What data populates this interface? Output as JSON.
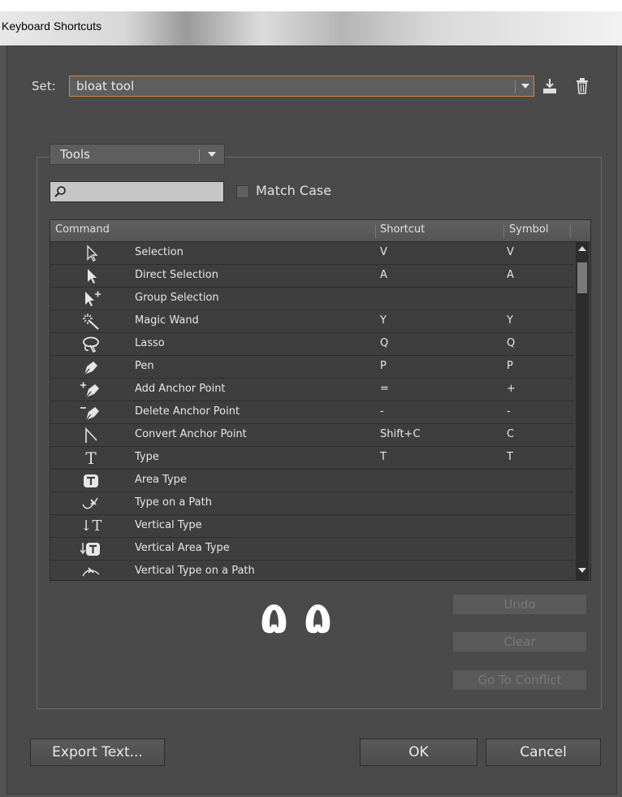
{
  "window": {
    "title": "Keyboard Shortcuts"
  },
  "set": {
    "label": "Set:",
    "value": "bloat tool",
    "save_icon": "save-set-icon",
    "delete_icon": "trash-icon"
  },
  "tools": {
    "category": "Tools",
    "search": {
      "value": "",
      "placeholder": ""
    },
    "match_case_label": "Match Case",
    "columns": [
      "Command",
      "Shortcut",
      "Symbol"
    ],
    "rows": [
      {
        "icon": "selection-arrow-icon",
        "command": "Selection",
        "shortcut": "V",
        "symbol": "V"
      },
      {
        "icon": "direct-selection-icon",
        "command": "Direct Selection",
        "shortcut": "A",
        "symbol": "A"
      },
      {
        "icon": "group-selection-icon",
        "command": "Group Selection",
        "shortcut": "",
        "symbol": ""
      },
      {
        "icon": "magic-wand-icon",
        "command": "Magic Wand",
        "shortcut": "Y",
        "symbol": "Y"
      },
      {
        "icon": "lasso-icon",
        "command": "Lasso",
        "shortcut": "Q",
        "symbol": "Q"
      },
      {
        "icon": "pen-icon",
        "command": "Pen",
        "shortcut": "P",
        "symbol": "P"
      },
      {
        "icon": "add-anchor-point-icon",
        "command": "Add Anchor Point",
        "shortcut": "=",
        "symbol": "+"
      },
      {
        "icon": "delete-anchor-point-icon",
        "command": "Delete Anchor Point",
        "shortcut": "-",
        "symbol": "-"
      },
      {
        "icon": "convert-anchor-point-icon",
        "command": "Convert Anchor Point",
        "shortcut": "Shift+C",
        "symbol": "C"
      },
      {
        "icon": "type-icon",
        "command": "Type",
        "shortcut": "T",
        "symbol": "T"
      },
      {
        "icon": "area-type-icon",
        "command": "Area Type",
        "shortcut": "",
        "symbol": ""
      },
      {
        "icon": "type-on-path-icon",
        "command": "Type on a Path",
        "shortcut": "",
        "symbol": ""
      },
      {
        "icon": "vertical-type-icon",
        "command": "Vertical Type",
        "shortcut": "",
        "symbol": ""
      },
      {
        "icon": "vertical-area-type-icon",
        "command": "Vertical Area Type",
        "shortcut": "",
        "symbol": ""
      },
      {
        "icon": "vertical-type-on-path-icon",
        "command": "Vertical Type on a Path",
        "shortcut": "",
        "symbol": ""
      }
    ]
  },
  "overlay_glyphs": [
    "۵",
    "۵"
  ],
  "buttons": {
    "undo": "Undo",
    "clear": "Clear",
    "go_to_conflict": "Go To Conflict",
    "export_text": "Export Text...",
    "ok": "OK",
    "cancel": "Cancel"
  }
}
